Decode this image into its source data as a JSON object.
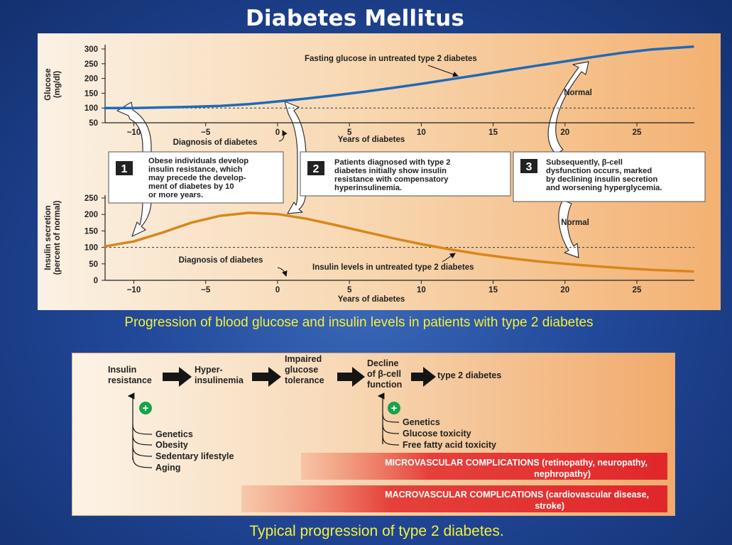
{
  "title": "Diabetes Mellitus",
  "caption_top": "Progression of blood glucose and insulin levels in patients with type 2 diabetes",
  "caption_bottom": "Typical progression of type 2 diabetes.",
  "colors": {
    "glucose_line": "#1f6ab8",
    "insulin_line": "#d8861c",
    "complication_band": "#e0272a"
  },
  "chart_data": [
    {
      "type": "line",
      "ylabel": "Glucose (mg/dl)",
      "xlabel": "Years of diabetes",
      "x_ticks": [
        -10,
        -5,
        0,
        5,
        10,
        15,
        20,
        25
      ],
      "y_ticks": [
        50,
        100,
        150,
        200,
        250,
        300
      ],
      "ylim": [
        50,
        300
      ],
      "xlim": [
        -12,
        29
      ],
      "normal_level": 100,
      "normal_label": "Normal",
      "diagnosis_label": "Diagnosis of diabetes",
      "series": [
        {
          "name": "Fasting glucose in untreated type 2 diabetes",
          "x": [
            -12,
            -10,
            -8,
            -6,
            -4,
            -2,
            0,
            2,
            4,
            6,
            8,
            10,
            12,
            14,
            16,
            18,
            20,
            22,
            24,
            26,
            28.9
          ],
          "y": [
            100,
            100,
            102,
            104,
            107,
            113,
            122,
            132,
            143,
            155,
            168,
            182,
            197,
            212,
            228,
            243,
            258,
            273,
            287,
            298,
            308
          ]
        }
      ]
    },
    {
      "type": "line",
      "ylabel": "Insulin secretion (percent of normal)",
      "xlabel": "Years of diabetes",
      "x_ticks": [
        -10,
        -5,
        0,
        5,
        10,
        15,
        20,
        25
      ],
      "y_ticks": [
        0,
        50,
        100,
        150,
        200,
        250
      ],
      "ylim": [
        0,
        250
      ],
      "xlim": [
        -12,
        29
      ],
      "normal_level": 100,
      "normal_label": "Normal",
      "diagnosis_label": "Diagnosis of diabetes",
      "series": [
        {
          "name": "Insulin levels in untreated type 2 diabetes",
          "x": [
            -12,
            -10,
            -8,
            -6,
            -4,
            -2,
            0,
            2,
            4,
            6,
            8,
            10,
            12,
            14,
            16,
            18,
            20,
            22,
            24,
            26,
            28.9
          ],
          "y": [
            103,
            118,
            145,
            175,
            196,
            205,
            201,
            187,
            168,
            148,
            128,
            110,
            94,
            80,
            68,
            58,
            50,
            43,
            37,
            32,
            27
          ]
        }
      ]
    }
  ],
  "callouts": [
    {
      "number": "1",
      "lines": [
        "Obese individuals develop",
        "insulin resistance, which",
        "may precede the develop-",
        "ment of diabetes by 10",
        "or more years."
      ]
    },
    {
      "number": "2",
      "lines": [
        "Patients diagnosed with type 2",
        "diabetes initially show insulin",
        "resistance with compensatory",
        "hyperinsulinemia."
      ]
    },
    {
      "number": "3",
      "lines": [
        "Subsequently, β-cell",
        "dysfunction occurs, marked",
        "by declining insulin secretion",
        "and worsening hyperglycemia."
      ]
    }
  ],
  "flow": {
    "steps": [
      [
        "Insulin",
        "resistance"
      ],
      [
        "Hyper-",
        "insulinemia"
      ],
      [
        "Impaired",
        "glucose",
        "tolerance"
      ],
      [
        "Decline",
        "of β-cell",
        "function"
      ],
      [
        "type 2 diabetes"
      ]
    ],
    "plus_symbol": "+",
    "factors_left": [
      "Genetics",
      "Obesity",
      "Sedentary lifestyle",
      "Aging"
    ],
    "factors_right": [
      "Genetics",
      "Glucose toxicity",
      "Free fatty acid toxicity"
    ],
    "micro": [
      "MICROVASCULAR COMPLICATIONS (retinopathy, neuropathy,",
      "nephropathy)"
    ],
    "macro": [
      "MACROVASCULAR COMPLICATIONS (cardiovascular disease,",
      "stroke)"
    ]
  }
}
